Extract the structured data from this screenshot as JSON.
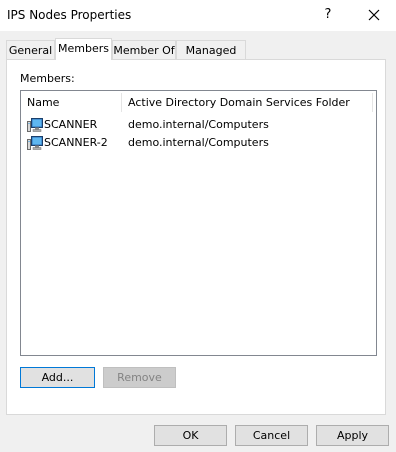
{
  "window": {
    "title": "IPS Nodes Properties",
    "help_label": "?"
  },
  "tabs": [
    {
      "label": "General"
    },
    {
      "label": "Members"
    },
    {
      "label": "Member Of"
    },
    {
      "label": "Managed By"
    }
  ],
  "active_tab": "Members",
  "members": {
    "label": "Members:",
    "columns": [
      "Name",
      "Active Directory Domain Services Folder"
    ],
    "rows": [
      {
        "name": "SCANNER",
        "folder": "demo.internal/Computers",
        "icon": "computer-icon"
      },
      {
        "name": "SCANNER-2",
        "folder": "demo.internal/Computers",
        "icon": "computer-icon"
      }
    ],
    "add_label": "Add...",
    "remove_label": "Remove"
  },
  "footer": {
    "ok_label": "OK",
    "cancel_label": "Cancel",
    "apply_label": "Apply"
  },
  "colors": {
    "focus_border": "#0078d7",
    "button_face": "#e1e1e1",
    "dialog_bg": "#f0f0f0"
  }
}
